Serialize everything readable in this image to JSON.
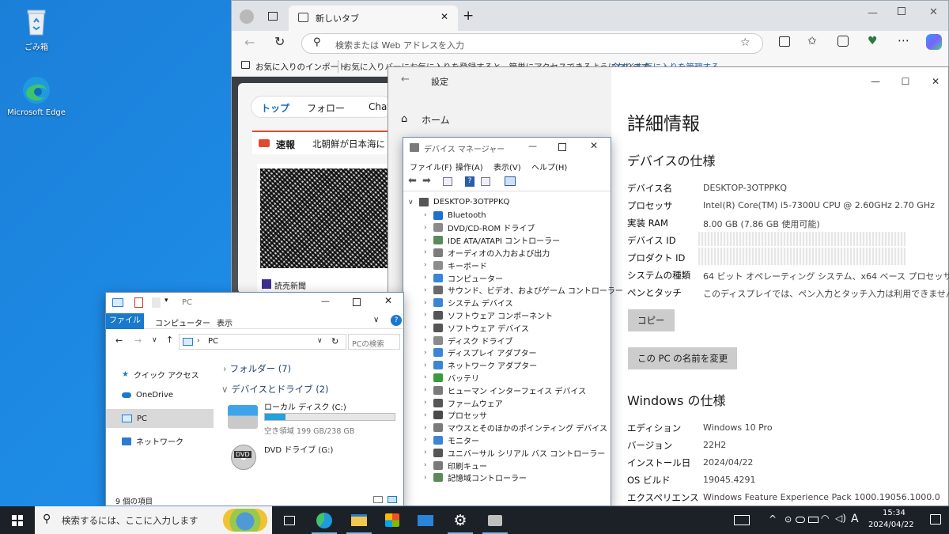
{
  "desktop": {
    "icons": [
      {
        "label": "ごみ箱"
      },
      {
        "label": "Microsoft Edge"
      }
    ]
  },
  "edge": {
    "tab_title": "新しいタブ",
    "omnibox_placeholder": "検索または Web アドレスを入力",
    "favbar": {
      "import_label": "お気に入りのインポート",
      "hint": "お気に入りバーにお気に入りを登録すると、簡単にアクセスできるようになります。",
      "manage_link": "今すぐお気に入りを管理する"
    },
    "feed": {
      "tabs": [
        "トップ",
        "フォロー",
        "Chat"
      ],
      "breaking_label": "速報",
      "breaking_text": "北朝鮮が日本海に",
      "source": "読売新聞"
    }
  },
  "settings": {
    "title": "設定",
    "home_label": "ホーム",
    "heading": "詳細情報",
    "device_spec_heading": "デバイスの仕様",
    "device_spec": [
      {
        "key": "デバイス名",
        "value": "DESKTOP-3OTPPKQ"
      },
      {
        "key": "プロセッサ",
        "value": "Intel(R) Core(TM) i5-7300U CPU @ 2.60GHz   2.70 GHz"
      },
      {
        "key": "実装 RAM",
        "value": "8.00 GB (7.86 GB 使用可能)"
      },
      {
        "key": "デバイス ID",
        "value": ""
      },
      {
        "key": "プロダクト ID",
        "value": ""
      },
      {
        "key": "システムの種類",
        "value": "64 ビット オペレーティング システム、x64 ベース プロセッサ"
      },
      {
        "key": "ペンとタッチ",
        "value": "このディスプレイでは、ペン入力とタッチ入力は利用できません"
      }
    ],
    "copy_button": "コピー",
    "rename_button": "この PC の名前を変更",
    "windows_spec_heading": "Windows の仕様",
    "windows_spec": [
      {
        "key": "エディション",
        "value": "Windows 10 Pro"
      },
      {
        "key": "バージョン",
        "value": "22H2"
      },
      {
        "key": "インストール日",
        "value": "2024/04/22"
      },
      {
        "key": "OS ビルド",
        "value": "19045.4291"
      },
      {
        "key": "エクスペリエンス",
        "value": "Windows Feature Experience Pack 1000.19056.1000.0"
      }
    ]
  },
  "devmgr": {
    "title": "デバイス マネージャー",
    "menu": [
      "ファイル(F)",
      "操作(A)",
      "表示(V)",
      "ヘルプ(H)"
    ],
    "root": "DESKTOP-3OTPPKQ",
    "items": [
      {
        "label": "Bluetooth",
        "color": "#1f6fd1"
      },
      {
        "label": "DVD/CD-ROM ドライブ",
        "color": "#8a8a8a"
      },
      {
        "label": "IDE ATA/ATAPI コントローラー",
        "color": "#5a8a5a"
      },
      {
        "label": "オーディオの入力および出力",
        "color": "#7d7d7d"
      },
      {
        "label": "キーボード",
        "color": "#8c8c8c"
      },
      {
        "label": "コンピューター",
        "color": "#3a86d4"
      },
      {
        "label": "サウンド、ビデオ、およびゲーム コントローラー",
        "color": "#6a6a6a"
      },
      {
        "label": "システム デバイス",
        "color": "#3a86d4"
      },
      {
        "label": "ソフトウェア コンポーネント",
        "color": "#555555"
      },
      {
        "label": "ソフトウェア デバイス",
        "color": "#555555"
      },
      {
        "label": "ディスク ドライブ",
        "color": "#8a8a8a"
      },
      {
        "label": "ディスプレイ アダプター",
        "color": "#3a86d4"
      },
      {
        "label": "ネットワーク アダプター",
        "color": "#3a86d4"
      },
      {
        "label": "バッテリ",
        "color": "#3c9a3c"
      },
      {
        "label": "ヒューマン インターフェイス デバイス",
        "color": "#7a7a7a"
      },
      {
        "label": "ファームウェア",
        "color": "#555555"
      },
      {
        "label": "プロセッサ",
        "color": "#4a4a4a"
      },
      {
        "label": "マウスとそのほかのポインティング デバイス",
        "color": "#7a7a7a"
      },
      {
        "label": "モニター",
        "color": "#3a86d4"
      },
      {
        "label": "ユニバーサル シリアル バス コントローラー",
        "color": "#555555"
      },
      {
        "label": "印刷キュー",
        "color": "#7a7a7a"
      },
      {
        "label": "記憶域コントローラー",
        "color": "#5a8a5a"
      }
    ]
  },
  "explorer": {
    "title": "PC",
    "ribbon_tabs": [
      "ファイル",
      "コンピューター",
      "表示"
    ],
    "address": "PC",
    "search_placeholder": "PCの検索",
    "nav": [
      "クイック アクセス",
      "OneDrive",
      "PC",
      "ネットワーク"
    ],
    "folders_group": "フォルダー (7)",
    "devices_group": "デバイスとドライブ (2)",
    "local_disk": {
      "name": "ローカル ディスク (C:)",
      "free": "空き領域 199 GB/238 GB",
      "used_fraction": 0.16
    },
    "dvd": {
      "name": "DVD ドライブ (G:)",
      "badge": "DVD"
    },
    "status": "9 個の項目"
  },
  "taskbar": {
    "search_placeholder": "検索するには、ここに入力します",
    "time": "15:34",
    "date": "2024/04/22",
    "ime": "A"
  }
}
